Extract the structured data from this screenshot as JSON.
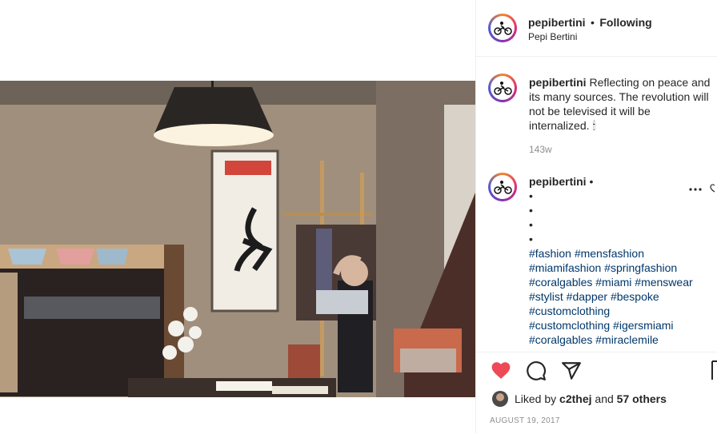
{
  "header": {
    "username": "pepibertini",
    "dot": "•",
    "follow_state": "Following",
    "full_name": "Pepi Bertini"
  },
  "caption": {
    "username": "pepibertini",
    "lines": [
      "Reflecting on peace and",
      "its many sources. The revolution will",
      "not be televised it will be",
      "internalized. 🕯"
    ],
    "time": "143w"
  },
  "comment": {
    "username": "pepibertini",
    "dot": "•",
    "bullets": [
      "•",
      "•",
      "•",
      "•"
    ],
    "hashtag_lines": [
      "#fashion #mensfashion",
      "#miamifashion #springfashion",
      "#coralgables #miami #menswear",
      "#stylist #dapper #bespoke",
      "#customclothing",
      "#customclothing #igersmiami",
      "#coralgables #miraclemile"
    ]
  },
  "likes": {
    "prefix": "Liked by",
    "user": "c2thej",
    "and": "and",
    "others": "57 others"
  },
  "date": "AUGUST 19, 2017",
  "colors": {
    "heart": "#ed4956",
    "link": "#00376b",
    "muted": "#8e8e8e"
  }
}
